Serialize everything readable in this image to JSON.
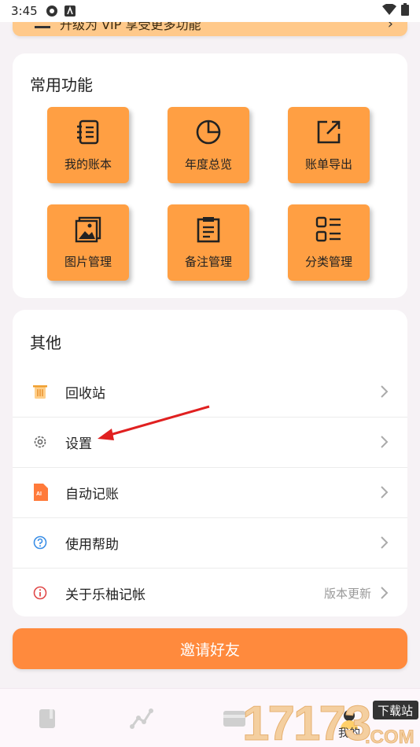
{
  "status_bar": {
    "time": "3:45"
  },
  "upgrade_banner": {
    "text": "升级为 VIP 享受更多功能"
  },
  "common": {
    "title": "常用功能",
    "tiles": [
      {
        "label": "我的账本",
        "icon": "ledger-icon"
      },
      {
        "label": "年度总览",
        "icon": "pie-chart-icon"
      },
      {
        "label": "账单导出",
        "icon": "export-icon"
      },
      {
        "label": "图片管理",
        "icon": "image-icon"
      },
      {
        "label": "备注管理",
        "icon": "note-icon"
      },
      {
        "label": "分类管理",
        "icon": "category-icon"
      }
    ]
  },
  "other": {
    "title": "其他",
    "rows": [
      {
        "label": "回收站",
        "icon": "trash-icon",
        "value": ""
      },
      {
        "label": "设置",
        "icon": "gear-icon",
        "value": ""
      },
      {
        "label": "自动记账",
        "icon": "ai-icon",
        "value": ""
      },
      {
        "label": "使用帮助",
        "icon": "help-icon",
        "value": ""
      },
      {
        "label": "关于乐柚记帐",
        "icon": "info-icon",
        "value": "版本更新"
      }
    ]
  },
  "invite_button": {
    "label": "邀请好友"
  },
  "bottom_nav": {
    "items": [
      {
        "icon": "book-icon"
      },
      {
        "icon": "trend-icon"
      },
      {
        "icon": "card-icon"
      },
      {
        "icon": "profile-icon",
        "label": "我的"
      }
    ]
  },
  "watermark": {
    "text": "17173",
    "badge": "下载站",
    "domain": ".COM"
  },
  "colors": {
    "accent": "#ff8a3d",
    "tile": "#ff9f43",
    "annotation_arrow": "#e02020"
  }
}
